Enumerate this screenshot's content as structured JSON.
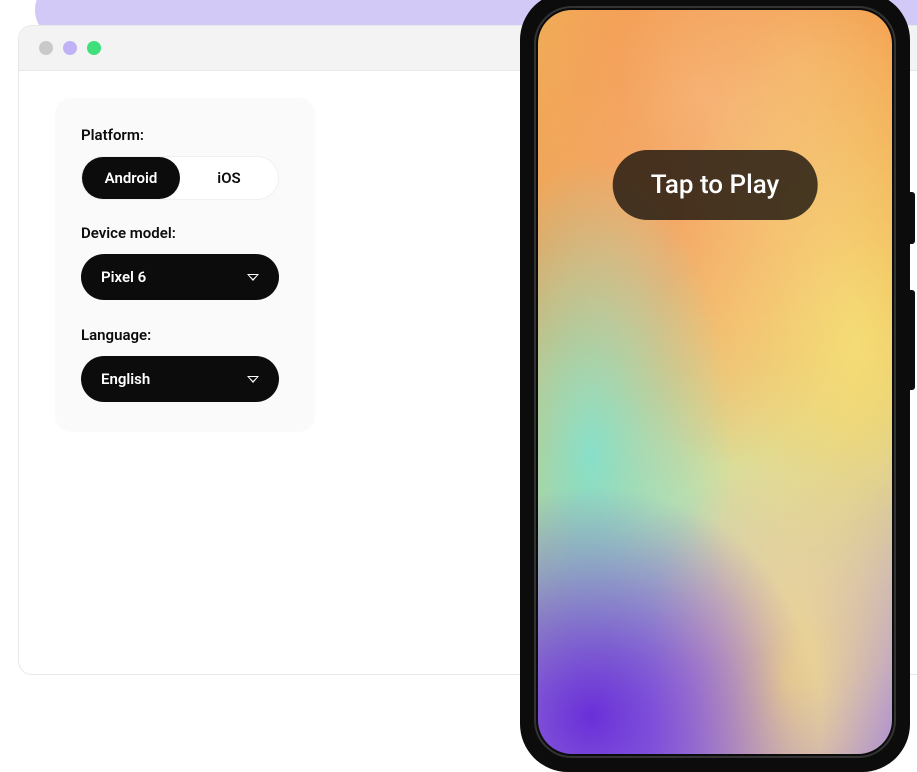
{
  "config": {
    "platform_label": "Platform:",
    "platform_options": {
      "android": "Android",
      "ios": "iOS"
    },
    "device_label": "Device model:",
    "device_selected": "Pixel 6",
    "language_label": "Language:",
    "language_selected": "English"
  },
  "phone": {
    "play_button": "Tap to Play"
  }
}
